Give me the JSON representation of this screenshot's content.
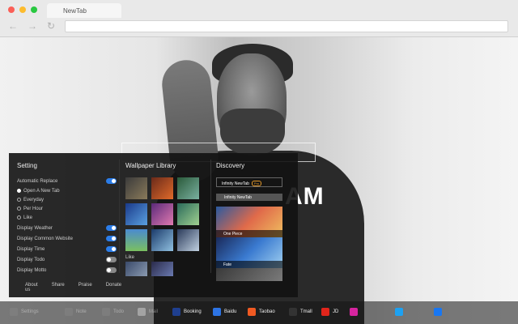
{
  "browser": {
    "tab_title": "NewTab",
    "back_icon": "←",
    "forward_icon": "→",
    "reload_icon": "↻"
  },
  "clock": "AM",
  "setting": {
    "title": "Setting",
    "auto_replace": "Automatic Replace",
    "options": [
      "Open A New Tab",
      "Everyday",
      "Per Hour",
      "Like"
    ],
    "toggles": [
      {
        "label": "Display Weather",
        "on": true
      },
      {
        "label": "Display Common Website",
        "on": true
      },
      {
        "label": "Display Time",
        "on": true
      },
      {
        "label": "Display Todo",
        "on": false
      },
      {
        "label": "Display Motto",
        "on": false
      }
    ],
    "footer": [
      "About us",
      "Share",
      "Praise",
      "Donate"
    ]
  },
  "wallpaper": {
    "title": "Wallpaper Library",
    "like_label": "Like"
  },
  "discovery": {
    "title": "Discovery",
    "card_title": "Infinity NewTab",
    "pro_badge": "Pro",
    "card_sub": "Infinity NewTab",
    "items": [
      "One Piece",
      "Fate"
    ]
  },
  "sites": [
    {
      "label": "Settings",
      "color": "#888888",
      "dim": true
    },
    {
      "label": "Note",
      "color": "#888888",
      "dim": true
    },
    {
      "label": "Todo",
      "color": "#888888",
      "dim": true
    },
    {
      "label": "Mail",
      "color": "#dddddd",
      "dim": true
    },
    {
      "label": "Booking",
      "color": "#1f3f8f",
      "dim": false
    },
    {
      "label": "Baidu",
      "color": "#2d74e5",
      "dim": false
    },
    {
      "label": "Taobao",
      "color": "#f05a22",
      "dim": false
    },
    {
      "label": "Tmall",
      "color": "#333333",
      "dim": false
    },
    {
      "label": "JD",
      "color": "#e1251b",
      "dim": false
    },
    {
      "label": "",
      "color": "#d6249f",
      "dim": false
    },
    {
      "label": "",
      "color": "#1da1f2",
      "dim": false
    },
    {
      "label": "",
      "color": "#1877f2",
      "dim": false
    }
  ]
}
